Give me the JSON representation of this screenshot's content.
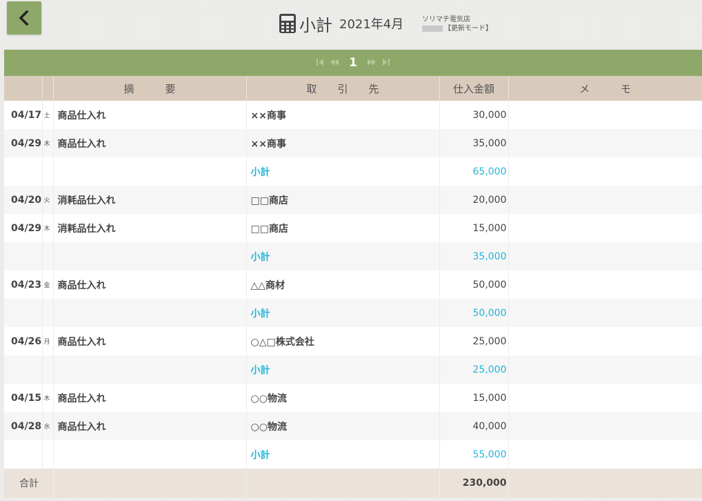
{
  "header": {
    "title": "小計",
    "period": "2021年4月",
    "store_name": "ソリマチ電気店",
    "mode": "【更新モード】"
  },
  "pager": {
    "first": "⏮",
    "prev": "◀◀",
    "current": "1",
    "next": "▶▶",
    "last": "⏭"
  },
  "columns": {
    "description": "摘　　　要",
    "vendor": "取　　引　　先",
    "amount": "仕入金額",
    "memo": "メ　　　モ"
  },
  "rows": [
    {
      "type": "entry",
      "date": "04/17",
      "dow": "土",
      "description": "商品仕入れ",
      "vendor": "××商事",
      "amount": "30,000",
      "memo": ""
    },
    {
      "type": "entry",
      "date": "04/29",
      "dow": "木",
      "description": "商品仕入れ",
      "vendor": "××商事",
      "amount": "35,000",
      "memo": ""
    },
    {
      "type": "subtotal",
      "label": "小計",
      "amount": "65,000"
    },
    {
      "type": "entry",
      "date": "04/20",
      "dow": "火",
      "description": "消耗品仕入れ",
      "vendor": "□□商店",
      "amount": "20,000",
      "memo": ""
    },
    {
      "type": "entry",
      "date": "04/29",
      "dow": "木",
      "description": "消耗品仕入れ",
      "vendor": "□□商店",
      "amount": "15,000",
      "memo": ""
    },
    {
      "type": "subtotal",
      "label": "小計",
      "amount": "35,000"
    },
    {
      "type": "entry",
      "date": "04/23",
      "dow": "金",
      "description": "商品仕入れ",
      "vendor": "△△商材",
      "amount": "50,000",
      "memo": ""
    },
    {
      "type": "subtotal",
      "label": "小計",
      "amount": "50,000"
    },
    {
      "type": "entry",
      "date": "04/26",
      "dow": "月",
      "description": "商品仕入れ",
      "vendor": "○△□株式会社",
      "amount": "25,000",
      "memo": ""
    },
    {
      "type": "subtotal",
      "label": "小計",
      "amount": "25,000"
    },
    {
      "type": "entry",
      "date": "04/15",
      "dow": "木",
      "description": "商品仕入れ",
      "vendor": "○○物流",
      "amount": "15,000",
      "memo": ""
    },
    {
      "type": "entry",
      "date": "04/28",
      "dow": "水",
      "description": "商品仕入れ",
      "vendor": "○○物流",
      "amount": "40,000",
      "memo": ""
    },
    {
      "type": "subtotal",
      "label": "小計",
      "amount": "55,000"
    }
  ],
  "total": {
    "label": "合計",
    "amount": "230,000"
  },
  "colors": {
    "accent_green": "#8ea86a",
    "header_tan": "#d9cbbc",
    "subtotal_cyan": "#23b5d8",
    "total_bg": "#ebe3da"
  },
  "icons": {
    "back": "chevron-left-icon",
    "title": "calculator-icon"
  }
}
